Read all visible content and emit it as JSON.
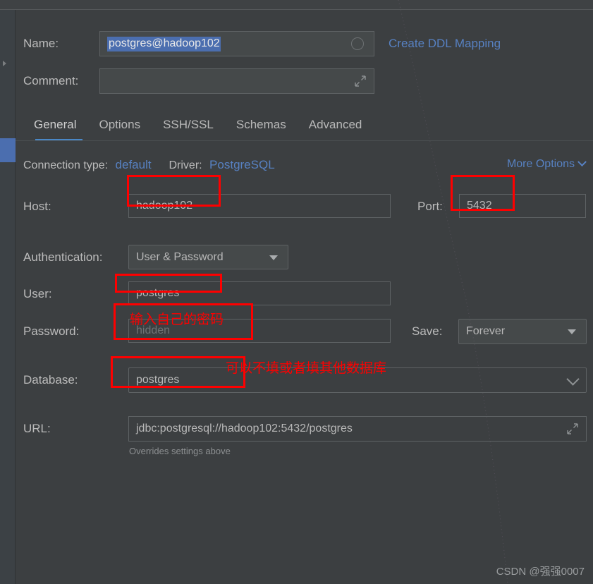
{
  "dialog": {
    "name_label": "Name:",
    "name_value": "postgres@hadoop102",
    "create_ddl_link": "Create DDL Mapping",
    "comment_label": "Comment:",
    "comment_value": ""
  },
  "tabs": [
    {
      "label": "General",
      "active": true
    },
    {
      "label": "Options",
      "active": false
    },
    {
      "label": "SSH/SSL",
      "active": false
    },
    {
      "label": "Schemas",
      "active": false
    },
    {
      "label": "Advanced",
      "active": false
    }
  ],
  "meta": {
    "connection_type_label": "Connection type:",
    "connection_type_value": "default",
    "driver_label": "Driver:",
    "driver_value": "PostgreSQL",
    "more_options": "More Options"
  },
  "fields": {
    "host_label": "Host:",
    "host_value": "hadoop102",
    "port_label": "Port:",
    "port_value": "5432",
    "auth_label": "Authentication:",
    "auth_value": "User & Password",
    "user_label": "User:",
    "user_value": "postgres",
    "password_label": "Password:",
    "password_placeholder": "hidden",
    "save_label": "Save:",
    "save_value": "Forever",
    "database_label": "Database:",
    "database_value": "postgres",
    "url_label": "URL:",
    "url_value": "jdbc:postgresql://hadoop102:5432/postgres",
    "url_hint": "Overrides settings above"
  },
  "annotations": {
    "password_note": "输入自己的密码",
    "database_note": "可以不填或者填其他数据库",
    "box_color": "#fe0000"
  },
  "watermark": "CSDN @强强0007",
  "colors": {
    "accent_blue": "#4b6eaf",
    "link_blue": "#5781c2",
    "panel_bg": "#3c3f41",
    "field_bg": "#45494a",
    "annotation_red": "#fe0000"
  }
}
